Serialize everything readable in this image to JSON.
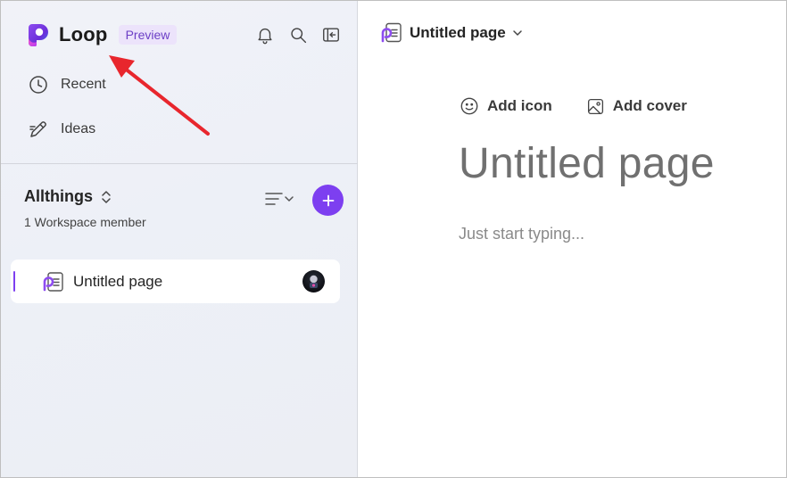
{
  "app": {
    "name": "Loop",
    "badge": "Preview"
  },
  "sidebar": {
    "top_icons": [
      "bell-icon",
      "search-icon",
      "collapse-panel-icon"
    ],
    "nav": [
      {
        "label": "Recent",
        "icon": "clock-icon"
      },
      {
        "label": "Ideas",
        "icon": "pencil-ideas-icon"
      }
    ],
    "workspace": {
      "name": "Allthings",
      "members": "1 Workspace member"
    },
    "pages": [
      {
        "label": "Untitled page"
      }
    ]
  },
  "main": {
    "header_title": "Untitled page",
    "actions": {
      "add_icon": "Add icon",
      "add_cover": "Add cover"
    },
    "page_title": "Untitled page",
    "body_placeholder": "Just start typing..."
  },
  "colors": {
    "accent": "#7d3ff0",
    "annotation_arrow": "#e8262d"
  }
}
